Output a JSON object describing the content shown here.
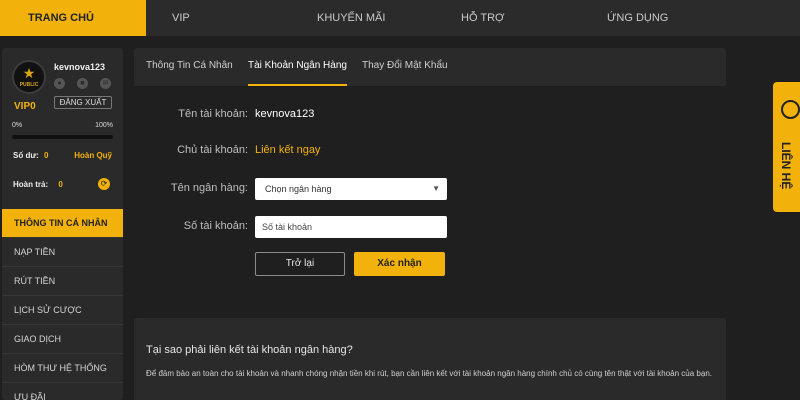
{
  "nav": {
    "items": [
      {
        "label": "TRANG CHỦ"
      },
      {
        "label": "VIP"
      },
      {
        "label": "KHUYẾN MÃI"
      },
      {
        "label": "HỖ TRỢ"
      },
      {
        "label": "ỨNG DỤNG"
      }
    ]
  },
  "user": {
    "logo_text": "PUBLIC",
    "name": "kevnova123",
    "vip": "VIP0",
    "logout": "ĐĂNG XUẤT",
    "progress_min": "0%",
    "progress_max": "100%",
    "progress": 0,
    "balance_label": "Số dư:",
    "balance_value": "0",
    "refund": "Hoàn Quỹ",
    "rebate_label": "Hoàn trả:",
    "rebate_value": "0"
  },
  "menu": {
    "items": [
      {
        "label": "THÔNG TIN CÁ NHÂN"
      },
      {
        "label": "NẠP TIỀN"
      },
      {
        "label": "RÚT TIỀN"
      },
      {
        "label": "LỊCH SỬ CƯỢC"
      },
      {
        "label": "GIAO DỊCH"
      },
      {
        "label": "HÒM THƯ HỆ THỐNG"
      },
      {
        "label": "ƯU ĐÃI"
      }
    ]
  },
  "tabs": [
    {
      "label": "Thông Tin Cá Nhân"
    },
    {
      "label": "Tài Khoản Ngân Hàng"
    },
    {
      "label": "Thay Đổi Mật Khẩu"
    }
  ],
  "form": {
    "account_name_label": "Tên tài khoản:",
    "account_name_value": "kevnova123",
    "owner_label": "Chủ tài khoản:",
    "owner_link": "Liên kết ngay",
    "bank_label": "Tên ngân hàng:",
    "bank_select": "Chọn ngân hàng",
    "number_label": "Số tài khoản:",
    "number_placeholder": "Số tài khoản",
    "back_label": "Trở lại",
    "confirm_label": "Xác nhận"
  },
  "info": {
    "title": "Tại sao phải liên kết tài khoản ngân hàng?",
    "text": "Để đảm bảo an toàn cho tài khoản và nhanh chóng nhận tiền khi rút, bạn cần liên kết với tài khoản ngân hàng chính chủ có cùng tên thật với tài khoản của bạn."
  },
  "support": {
    "label": "LIÊN HỆ"
  },
  "colors": {
    "accent": "#f3b20b",
    "background": "#1f1f1f",
    "panel": "#2a2a2a"
  }
}
